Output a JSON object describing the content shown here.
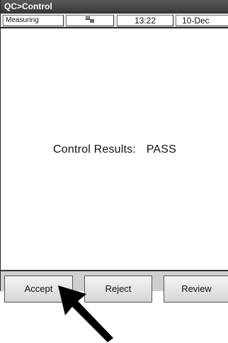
{
  "titlebar": {
    "title": "QC>Control"
  },
  "statusbar": {
    "mode": "Measuring",
    "network_icon": "network-icon",
    "time": "13:22",
    "date": "10-Dec"
  },
  "main": {
    "result_label": "Control Results:",
    "result_value": "PASS"
  },
  "buttons": {
    "accept": "Accept",
    "reject": "Reject",
    "review": "Review"
  },
  "overlay": {
    "pointer_icon": "arrow-pointer-icon"
  }
}
